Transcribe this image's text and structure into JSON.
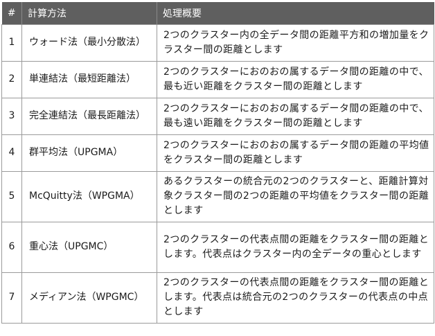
{
  "table": {
    "headers": [
      "#",
      "計算方法",
      "処理概要"
    ],
    "rows": [
      {
        "num": "1",
        "method": "ウォード法（最小分散法）",
        "desc": "2つのクラスター内の全データ間の距離平方和の増加量をクラスター間の距離とします"
      },
      {
        "num": "2",
        "method": "単連結法（最短距離法）",
        "desc": "2つのクラスターにおのおの属するデータ間の距離の中で、最も近い距離をクラスター間の距離とします"
      },
      {
        "num": "3",
        "method": "完全連結法（最長距離法）",
        "desc": "2つのクラスターにおのおの属するデータ間の距離の中で、最も遠い距離をクラスター間の距離とします"
      },
      {
        "num": "4",
        "method": "群平均法（UPGMA）",
        "desc": "2つのクラスターにおのおの属するデータ間の距離の平均値をクラスター間の距離とします"
      },
      {
        "num": "5",
        "method": "McQuitty法（WPGMA）",
        "desc": "あるクラスターの統合元の2つのクラスターと、距離計算対象クラスター間の2つの距離の平均値をクラスター間の距離とします"
      },
      {
        "num": "6",
        "method": "重心法（UPGMC）",
        "desc": "2つのクラスターの代表点間の距離をクラスター間の距離とします。代表点はクラスター内の全データの重心とします"
      },
      {
        "num": "7",
        "method": "メディアン法（WPGMC）",
        "desc": "2つのクラスターの代表点間の距離をクラスター間の距離とします。代表点は統合元の2つのクラスターの代表点の中点とします"
      }
    ]
  }
}
